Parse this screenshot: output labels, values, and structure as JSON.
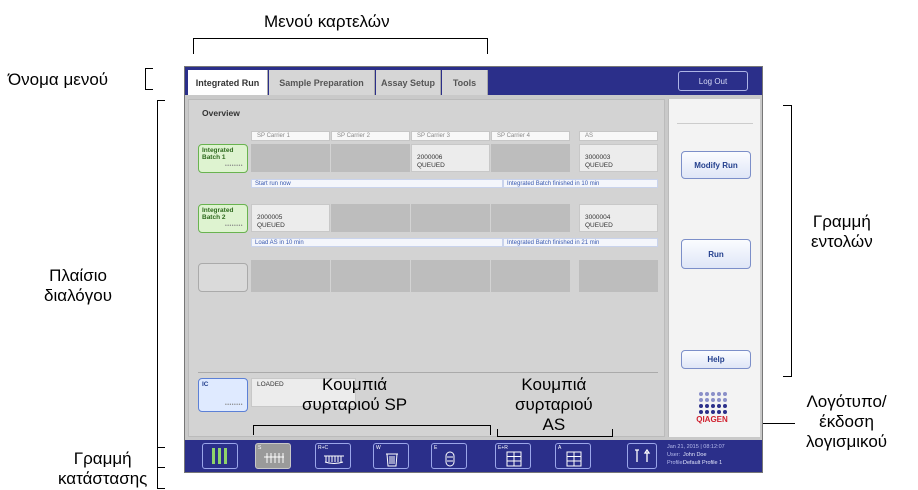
{
  "callouts": {
    "tab_menu": "Μενού καρτελών",
    "menu_name": "Όνομα μενού",
    "dialog_box": [
      "Πλαίσιο",
      "διαλόγου"
    ],
    "command_bar": [
      "Γραμμή",
      "εντολών"
    ],
    "logo_version": [
      "Λογότυπο/",
      "έκδοση",
      "λογισμικού"
    ],
    "status_bar": [
      "Γραμμή",
      "κατάστασης"
    ],
    "sp_buttons": [
      "Κουμπιά",
      "συρταριού SP"
    ],
    "as_buttons": [
      "Κουμπιά",
      "συρταριού",
      "AS"
    ]
  },
  "tabs": [
    "Integrated Run",
    "Sample Preparation",
    "Assay Setup",
    "Tools"
  ],
  "logout_label": "Log Out",
  "overview": {
    "title": "Overview",
    "columns": [
      "SP Carrier 1",
      "SP Carrier 2",
      "SP Carrier 3",
      "SP Carrier 4",
      "AS"
    ],
    "batch1": {
      "label": [
        "Integrated",
        "Batch 1"
      ],
      "carrier3": [
        "2000006",
        "QUEUED"
      ],
      "as": [
        "3000003",
        "QUEUED"
      ],
      "info_left": "Start run now",
      "info_right": "Integrated Batch finished in 10 min"
    },
    "batch2": {
      "label": [
        "Integrated",
        "Batch 2"
      ],
      "carrier1": [
        "2000005",
        "QUEUED"
      ],
      "as": [
        "3000004",
        "QUEUED"
      ],
      "info_left": "Load AS in 10 min",
      "info_right": "Integrated Batch finished in 21 min"
    },
    "ic": {
      "label": "IC",
      "status": "LOADED"
    },
    "dots": "••••••••"
  },
  "commands": {
    "modify_run": "Modify Run",
    "run": "Run",
    "help": "Help"
  },
  "logo_text": "QIAGEN",
  "status_buttons": [
    {
      "label": "S",
      "icon": "tube-rack-icon"
    },
    {
      "label": "R+C",
      "icon": "reagent-icon"
    },
    {
      "label": "W",
      "icon": "waste-bin-icon"
    },
    {
      "label": "E",
      "icon": "eluate-icon"
    },
    {
      "label": "E+R",
      "icon": "eluate-reagent-icon"
    },
    {
      "label": "A",
      "icon": "assay-icon"
    }
  ],
  "status_info": {
    "datetime": "Jan 21, 2015 | 08:12:07",
    "user_label": "User:",
    "user": "John Doe",
    "profile_label": "Profile:",
    "profile": "Default Profile 1"
  },
  "colors": {
    "bar": "#2b2f8a",
    "accent": "#24408e",
    "qiagen_red": "#d0202e"
  }
}
